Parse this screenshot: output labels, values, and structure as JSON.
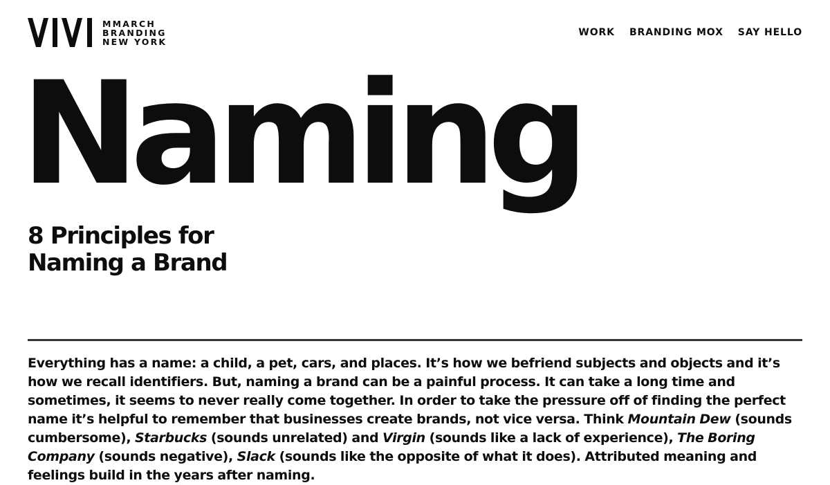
{
  "brand": {
    "logo_icon": "mmarch-monogram-logo",
    "line1": "MMARCH",
    "line2": "BRANDING",
    "line3": "NEW YORK"
  },
  "nav": {
    "items": [
      {
        "label": "WORK"
      },
      {
        "label": "BRANDING MOX"
      },
      {
        "label": "SAY HELLO"
      }
    ]
  },
  "hero": {
    "title": "Naming",
    "subtitle_line1": "8 Principles for",
    "subtitle_line2": "Naming a Brand"
  },
  "article": {
    "paragraph": [
      {
        "text": "Everything has a name: a child, a pet, cars, and places. It’s how we befriend subjects and objects and it’s how we recall identifiers. But, naming a brand can be a painful process. It can take a long time and sometimes, it seems to never really come together. In order to take the pressure off of finding the perfect name it’s helpful to remember that businesses create brands, not vice versa. Think "
      },
      {
        "text": "Mountain Dew",
        "italic": true
      },
      {
        "text": " (sounds cumbersome), "
      },
      {
        "text": "Starbucks",
        "italic": true
      },
      {
        "text": " (sounds unrelated) and "
      },
      {
        "text": "Virgin",
        "italic": true
      },
      {
        "text": " (sounds like a lack of experience), "
      },
      {
        "text": "The Boring Company",
        "italic": true
      },
      {
        "text": " (sounds negative), "
      },
      {
        "text": "Slack",
        "italic": true
      },
      {
        "text": " (sounds like the opposite of what it does). Attributed meaning and feelings build in the years after naming."
      }
    ]
  },
  "colors": {
    "text": "#0d0d0d",
    "background": "#ffffff",
    "divider": "#333333"
  }
}
